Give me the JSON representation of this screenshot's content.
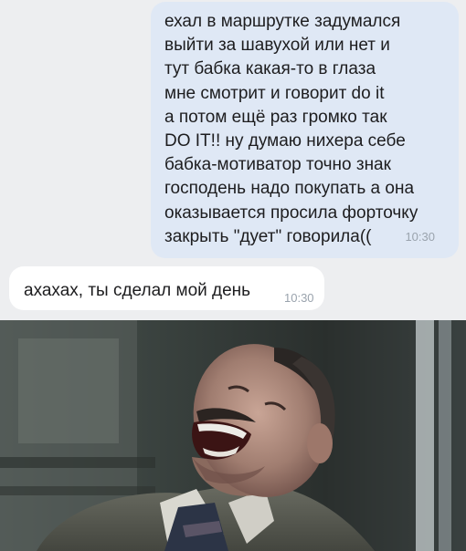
{
  "messages": [
    {
      "direction": "outgoing",
      "lines": [
        "ехал в маршрутке задумался",
        "выйти за шавухой или нет и",
        "тут бабка какая-то в глаза",
        "мне смотрит и говорит do it",
        "а потом ещё раз громко так",
        "DO IT!! ну думаю нихера себе",
        "бабка-мотиватор точно знак",
        "господень надо покупать а она",
        "оказывается просила форточку",
        "закрыть \"дует\" говорила(("
      ],
      "time": "10:30"
    },
    {
      "direction": "incoming",
      "text": "ахахах, ты сделал мой день",
      "time": "10:30"
    }
  ],
  "colors": {
    "background": "#edeef0",
    "outgoing_bubble": "#dfe8f5",
    "incoming_bubble": "#ffffff",
    "time_text": "#9aa3ad"
  },
  "image": {
    "subject": "laughing-man-photo"
  }
}
